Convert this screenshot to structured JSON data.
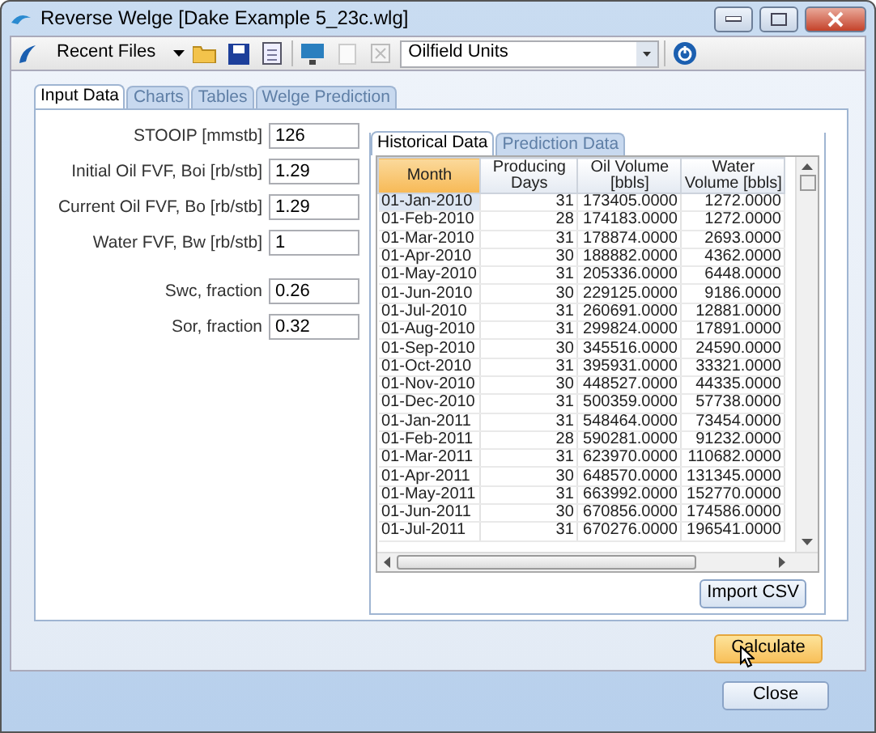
{
  "window": {
    "title": "Reverse Welge [Dake Example 5_23c.wlg]"
  },
  "toolbar": {
    "recent_files": "Recent Files",
    "units": "Oilfield Units"
  },
  "tabs": [
    {
      "label": "Input Data",
      "selected": true
    },
    {
      "label": "Charts",
      "selected": false
    },
    {
      "label": "Tables",
      "selected": false
    },
    {
      "label": "Welge Prediction",
      "selected": false
    }
  ],
  "inputs": [
    {
      "label": "STOOIP [mmstb]",
      "value": "126"
    },
    {
      "label": "Initial Oil FVF, Boi [rb/stb]",
      "value": "1.29"
    },
    {
      "label": "Current Oil FVF, Bo [rb/stb]",
      "value": "1.29"
    },
    {
      "label": "Water FVF, Bw [rb/stb]",
      "value": "1"
    },
    {
      "label": "Swc, fraction",
      "value": "0.26"
    },
    {
      "label": "Sor, fraction",
      "value": "0.32"
    }
  ],
  "data_tabs": [
    {
      "label": "Historical Data",
      "selected": true
    },
    {
      "label": "Prediction Data",
      "selected": false
    }
  ],
  "table": {
    "columns": [
      {
        "label": "Month",
        "selected": true
      },
      {
        "label": "Producing Days",
        "selected": false
      },
      {
        "label": "Oil Volume [bbls]",
        "selected": false
      },
      {
        "label": "Water Volume [bbls]",
        "selected": false
      }
    ],
    "rows": [
      {
        "selected": true,
        "cells": [
          "01-Jan-2010",
          "31",
          "173405.0000",
          "1272.0000"
        ]
      },
      {
        "selected": false,
        "cells": [
          "01-Feb-2010",
          "28",
          "174183.0000",
          "1272.0000"
        ]
      },
      {
        "selected": false,
        "cells": [
          "01-Mar-2010",
          "31",
          "178874.0000",
          "2693.0000"
        ]
      },
      {
        "selected": false,
        "cells": [
          "01-Apr-2010",
          "30",
          "188882.0000",
          "4362.0000"
        ]
      },
      {
        "selected": false,
        "cells": [
          "01-May-2010",
          "31",
          "205336.0000",
          "6448.0000"
        ]
      },
      {
        "selected": false,
        "cells": [
          "01-Jun-2010",
          "30",
          "229125.0000",
          "9186.0000"
        ]
      },
      {
        "selected": false,
        "cells": [
          "01-Jul-2010",
          "31",
          "260691.0000",
          "12881.0000"
        ]
      },
      {
        "selected": false,
        "cells": [
          "01-Aug-2010",
          "31",
          "299824.0000",
          "17891.0000"
        ]
      },
      {
        "selected": false,
        "cells": [
          "01-Sep-2010",
          "30",
          "345516.0000",
          "24590.0000"
        ]
      },
      {
        "selected": false,
        "cells": [
          "01-Oct-2010",
          "31",
          "395931.0000",
          "33321.0000"
        ]
      },
      {
        "selected": false,
        "cells": [
          "01-Nov-2010",
          "30",
          "448527.0000",
          "44335.0000"
        ]
      },
      {
        "selected": false,
        "cells": [
          "01-Dec-2010",
          "31",
          "500359.0000",
          "57738.0000"
        ]
      },
      {
        "selected": false,
        "cells": [
          "01-Jan-2011",
          "31",
          "548464.0000",
          "73454.0000"
        ]
      },
      {
        "selected": false,
        "cells": [
          "01-Feb-2011",
          "28",
          "590281.0000",
          "91232.0000"
        ]
      },
      {
        "selected": false,
        "cells": [
          "01-Mar-2011",
          "31",
          "623970.0000",
          "110682.0000"
        ]
      },
      {
        "selected": false,
        "cells": [
          "01-Apr-2011",
          "30",
          "648570.0000",
          "131345.0000"
        ]
      },
      {
        "selected": false,
        "cells": [
          "01-May-2011",
          "31",
          "663992.0000",
          "152770.0000"
        ]
      },
      {
        "selected": false,
        "cells": [
          "01-Jun-2011",
          "30",
          "670856.0000",
          "174586.0000"
        ]
      },
      {
        "selected": false,
        "cells": [
          "01-Jul-2011",
          "31",
          "670276.0000",
          "196541.0000"
        ]
      }
    ]
  },
  "buttons": {
    "import": "Import CSV",
    "calculate": "Calculate",
    "close": "Close"
  }
}
